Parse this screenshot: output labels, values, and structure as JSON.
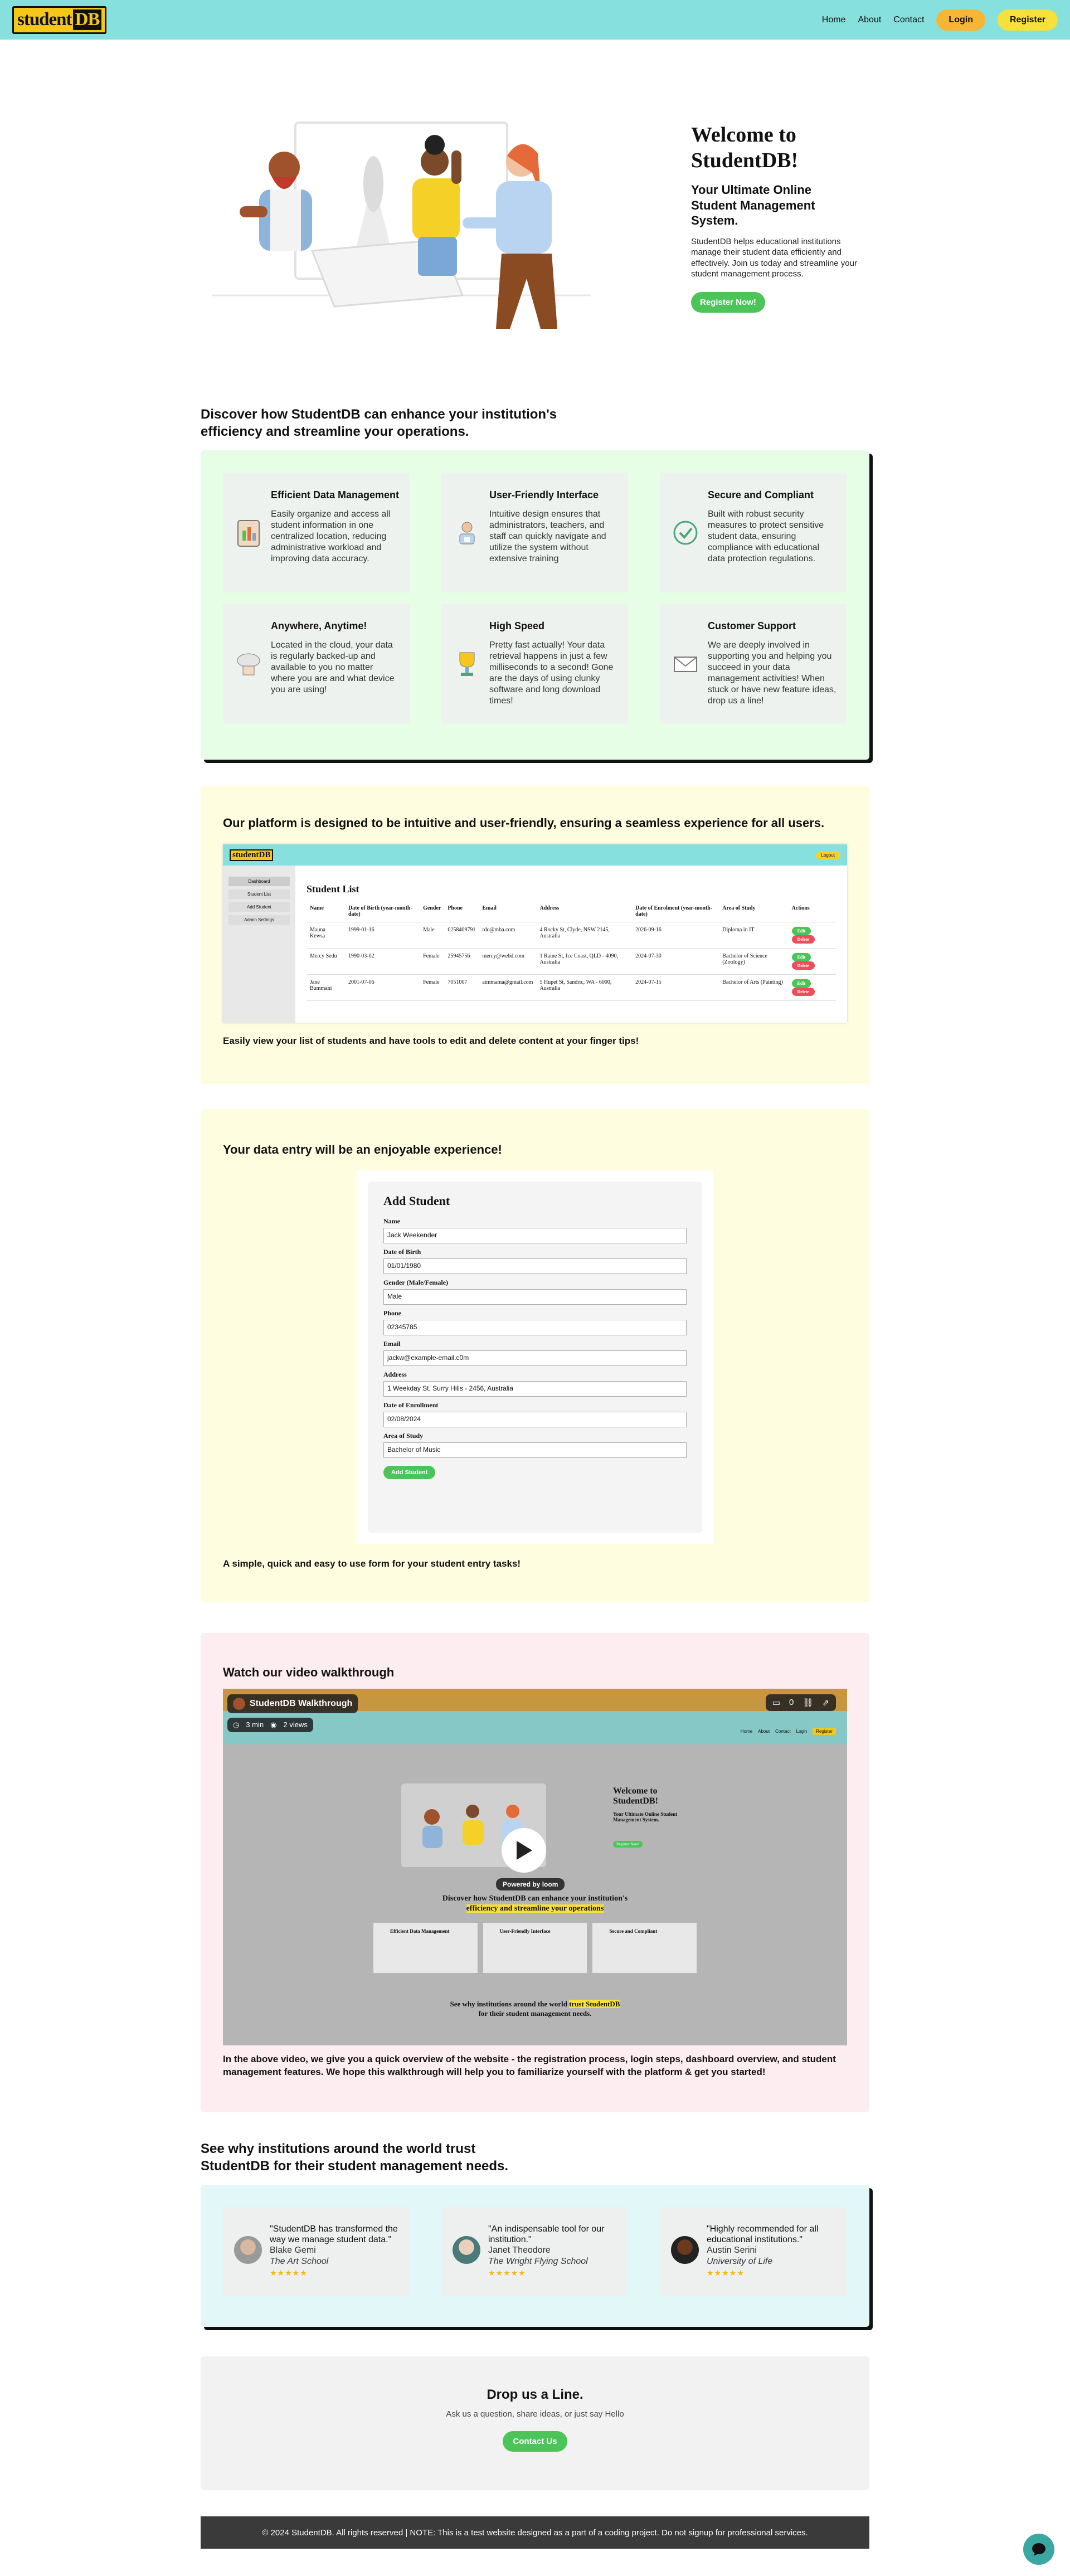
{
  "nav": {
    "logo_part1": "student",
    "logo_part2": "DB",
    "links": [
      "Home",
      "About",
      "Contact"
    ],
    "login": "Login",
    "register": "Register"
  },
  "hero": {
    "title": "Welcome to StudentDB!",
    "subtitle": "Your Ultimate Online Student Management System.",
    "body": "StudentDB helps educational institutions manage their student data efficiently and effectively. Join us today and streamline your student management process.",
    "cta": "Register Now!"
  },
  "features": {
    "heading": "Discover how StudentDB can enhance your institution's efficiency and streamline your operations.",
    "items": [
      {
        "title": "Efficient Data Management",
        "text": "Easily organize and access all student information in one centralized location, reducing administrative workload and improving data accuracy.",
        "icon": "clipboard-chart-icon"
      },
      {
        "title": "User-Friendly Interface",
        "text": "Intuitive design ensures that administrators, teachers, and staff can quickly navigate and utilize the system without extensive training",
        "icon": "user-device-icon"
      },
      {
        "title": "Secure and Compliant",
        "text": "Built with robust security measures to protect sensitive student data, ensuring compliance with educational data protection regulations.",
        "icon": "shield-check-icon"
      },
      {
        "title": "Anywhere, Anytime!",
        "text": "Located in the cloud, your data is regularly backed-up and available to you no matter where you are and what device you are using!",
        "icon": "cloud-icon"
      },
      {
        "title": "High Speed",
        "text": "Pretty fast actually! Your data retrieval happens in just a few milliseconds to a second! Gone are the days of using clunky software and long download times!",
        "icon": "trophy-icon"
      },
      {
        "title": "Customer Support",
        "text": "We are deeply involved in supporting you and helping you succeed in your data management activities! When stuck or have new feature ideas, drop us a line!",
        "icon": "envelope-icon"
      }
    ]
  },
  "platform": {
    "heading": "Our platform is designed to be intuitive and user-friendly, ensuring a seamless experience for all users.",
    "caption": "Easily view your list of students and have tools to edit and delete content at your finger tips!",
    "mock": {
      "logout": "Logout",
      "sidebar": [
        "Dashboard",
        "Student List",
        "Add Student",
        "Admin Settings"
      ],
      "title": "Student List",
      "headers": [
        "Name",
        "Date of Birth (year-month-date)",
        "Gender",
        "Phone",
        "Email",
        "Address",
        "Date of Enrolment (year-month-date)",
        "Area of Study",
        "Actions"
      ],
      "rows": [
        [
          "Mauna Kewsa",
          "1999-01-16",
          "Male",
          "0258409791",
          "rdc@mba.com",
          "4 Rocky St, Clyde, NSW 2145, Australia",
          "2026-09-16",
          "Diploma in IT"
        ],
        [
          "Mercy Sedu",
          "1990-03-02",
          "Female",
          "25945756",
          "mercy@webd.com",
          "1 Raine St, Ice Coast, QLD - 4090, Australia",
          "2024-07-30",
          "Bachelor of Science (Zoology)"
        ],
        [
          "Jane Bummani",
          "2001-07-06",
          "Female",
          "7051007",
          "aimmama@gmail.com",
          "5 Hupet St, Sandric, WA - 6000, Australia",
          "2024-07-15",
          "Bachelor of Arts (Painting)"
        ]
      ],
      "edit": "Edit",
      "delete": "Delete"
    }
  },
  "entry": {
    "heading": "Your data entry will be an enjoyable experience!",
    "caption": "A simple, quick and easy to use form for your student entry tasks!",
    "form": {
      "title": "Add Student",
      "fields": [
        {
          "label": "Name",
          "value": "Jack Weekender"
        },
        {
          "label": "Date of Birth",
          "value": "01/01/1980"
        },
        {
          "label": "Gender (Male/Female)",
          "value": "Male"
        },
        {
          "label": "Phone",
          "value": "02345785"
        },
        {
          "label": "Email",
          "value": "jackw@example-email.c0m"
        },
        {
          "label": "Address",
          "value": "1 Weekday St, Surry Hills - 2456, Australia"
        },
        {
          "label": "Date of Enrollment",
          "value": "02/08/2024"
        },
        {
          "label": "Area of Study",
          "value": "Bachelor of Music"
        }
      ],
      "submit": "Add Student"
    }
  },
  "video": {
    "heading": "Watch our video walkthrough",
    "player_title": "StudentDB Walkthrough",
    "duration": "3 min",
    "views": "2 views",
    "comments": "0",
    "powered": "Powered by",
    "brand": "loom",
    "inner": {
      "links": [
        "Home",
        "About",
        "Contact",
        "Login"
      ],
      "register": "Register",
      "title": "Welcome to StudentDB!",
      "subtitle": "Your Ultimate Online Student Management System.",
      "cta": "Register Now!",
      "discover_1": "Discover how StudentDB can enhance your institution's",
      "discover_2": "efficiency and streamline your operations",
      "cards": [
        "Efficient Data Management",
        "User-Friendly Interface",
        "Secure and Compliant"
      ],
      "see_1": "See why institutions around the world",
      "see_hl": "trust StudentDB",
      "see_2": "for their student management needs."
    },
    "caption": "In the above video, we give you a quick overview of the website - the registration process, login steps, dashboard overview, and student management features. We hope this walkthrough will help you to familiarize yourself with the platform & get you started!"
  },
  "testimonials": {
    "heading": "See why institutions around the world trust StudentDB for their student management needs.",
    "items": [
      {
        "quote": "\"StudentDB has transformed the way we manage student data.\"",
        "name": "Blake Gemi",
        "org": "The Art School",
        "stars": "★★★★★"
      },
      {
        "quote": "\"An indispensable tool for our institution.\"",
        "name": "Janet Theodore",
        "org": "The Wright Flying School",
        "stars": "★★★★★"
      },
      {
        "quote": "\"Highly recommended for all educational institutions.\"",
        "name": "Austin Serini",
        "org": "University of Life",
        "stars": "★★★★★"
      }
    ]
  },
  "contact": {
    "title": "Drop us a Line.",
    "text": "Ask us a question, share ideas, or just say Hello",
    "button": "Contact Us"
  },
  "footer": "© 2024 StudentDB. All rights reserved | NOTE: This is a test website designed as a part of a coding project. Do not signup for professional services.",
  "colors": {
    "nav": "#86e1de",
    "accent": "#f5c71a",
    "green": "#4cc45a",
    "mint": "#e6fde6",
    "cream": "#fffde0",
    "pink": "#fdecf0",
    "aqua": "#e2f8f8"
  }
}
